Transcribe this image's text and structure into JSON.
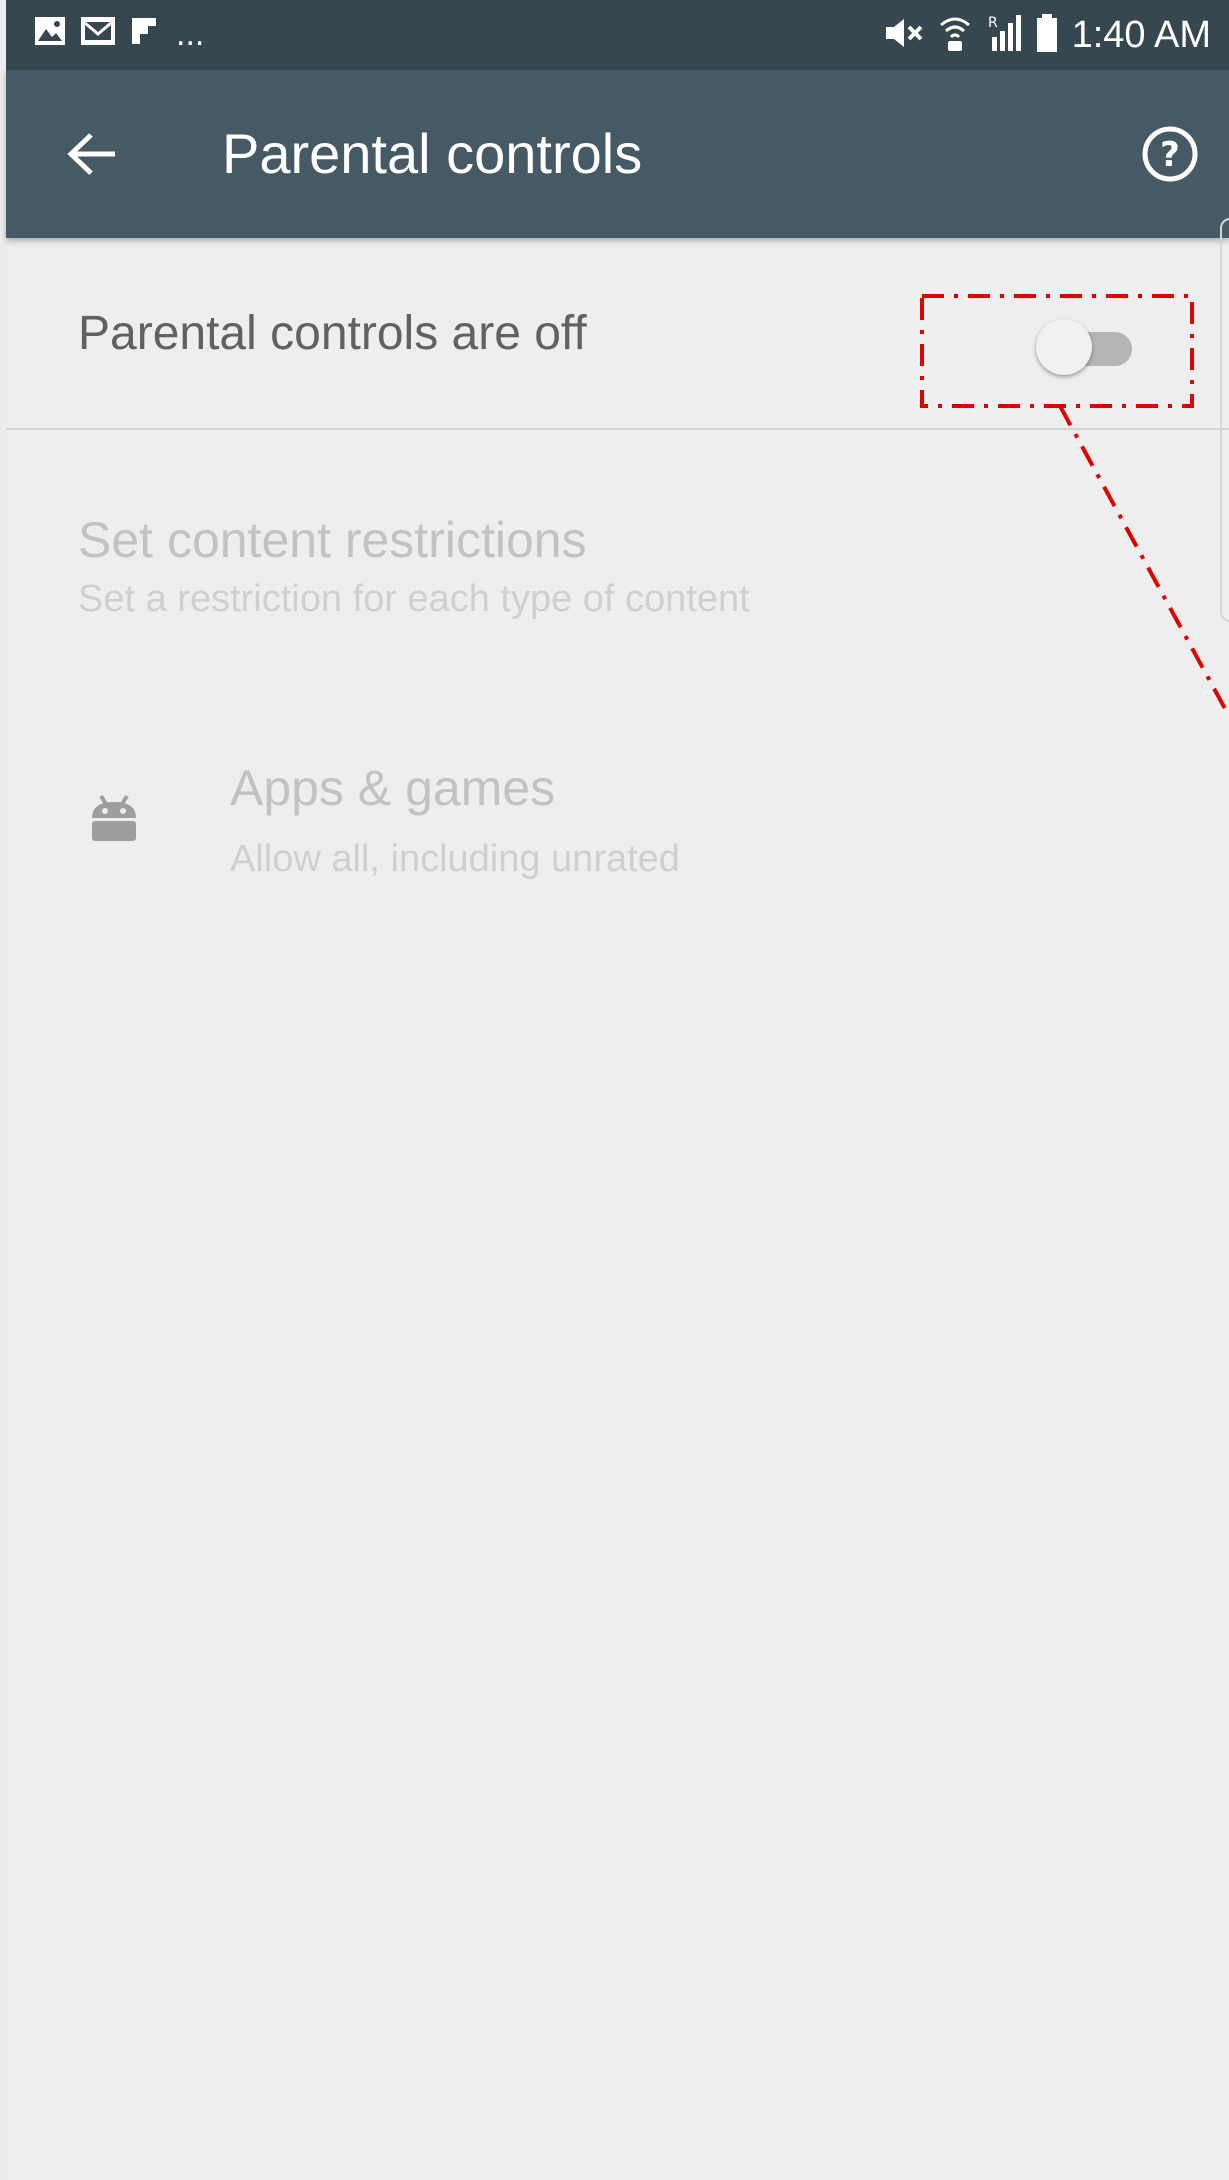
{
  "status_bar": {
    "left_icons": [
      "gallery-icon",
      "email-icon",
      "flipboard-icon"
    ],
    "overflow": "...",
    "right_icons": [
      "mute-icon",
      "wifi-calling-icon",
      "signal-roaming-icon",
      "battery-icon"
    ],
    "time": "1:40 AM"
  },
  "app_bar": {
    "title": "Parental controls",
    "back_icon": "arrow-back-icon",
    "help_icon": "help-circle-icon",
    "background": "#455a64"
  },
  "toggle": {
    "label": "Parental controls are off",
    "state": "off"
  },
  "content_restrictions": {
    "title": "Set content restrictions",
    "subtitle": "Set a restriction for each type of content"
  },
  "items": [
    {
      "icon": "android-icon",
      "title": "Apps & games",
      "subtitle": "Allow all, including unrated"
    }
  ],
  "annotation": {
    "color": "#e10000",
    "style": "dash-dot"
  }
}
